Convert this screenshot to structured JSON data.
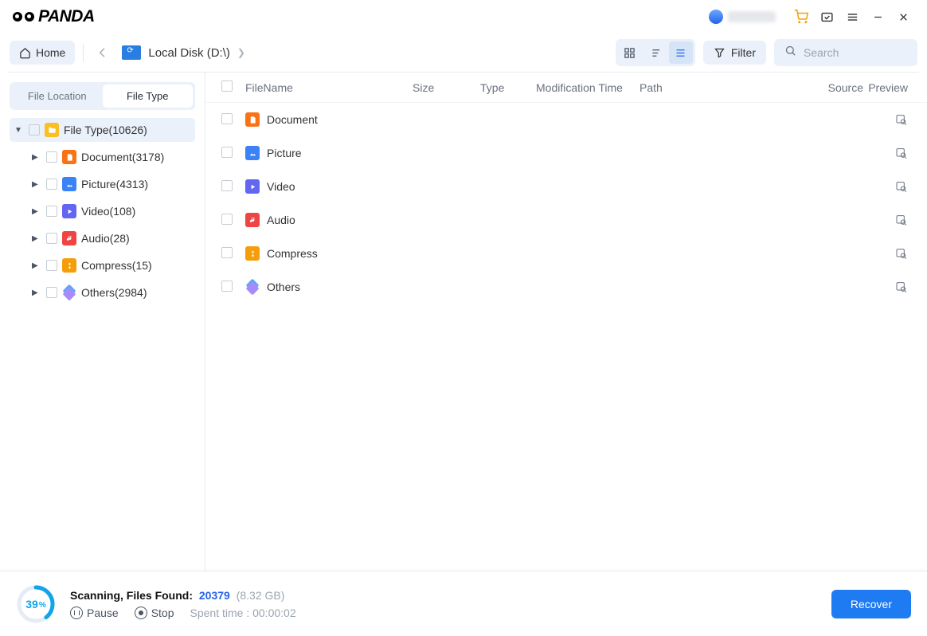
{
  "app": {
    "name": "PANDA"
  },
  "toolbar": {
    "home": "Home",
    "breadcrumb": "Local Disk (D:\\)",
    "filter": "Filter",
    "search_placeholder": "Search"
  },
  "sidebar": {
    "tabs": {
      "location": "File Location",
      "type": "File Type"
    },
    "root_label": "File Type(10626)",
    "items": [
      {
        "label": "Document(3178)",
        "icon": "doc"
      },
      {
        "label": "Picture(4313)",
        "icon": "pic"
      },
      {
        "label": "Video(108)",
        "icon": "vid"
      },
      {
        "label": "Audio(28)",
        "icon": "aud"
      },
      {
        "label": "Compress(15)",
        "icon": "comp"
      },
      {
        "label": "Others(2984)",
        "icon": "other"
      }
    ]
  },
  "columns": {
    "name": "FileName",
    "size": "Size",
    "type": "Type",
    "mod": "Modification Time",
    "path": "Path",
    "src": "Source",
    "prev": "Preview"
  },
  "rows": [
    {
      "label": "Document",
      "icon": "doc"
    },
    {
      "label": "Picture",
      "icon": "pic"
    },
    {
      "label": "Video",
      "icon": "vid"
    },
    {
      "label": "Audio",
      "icon": "aud"
    },
    {
      "label": "Compress",
      "icon": "comp"
    },
    {
      "label": "Others",
      "icon": "other"
    }
  ],
  "footer": {
    "percent": "39",
    "status_label": "Scanning, Files Found:",
    "count": "20379",
    "size": "(8.32 GB)",
    "pause": "Pause",
    "stop": "Stop",
    "time": "Spent time : 00:00:02",
    "recover": "Recover"
  }
}
